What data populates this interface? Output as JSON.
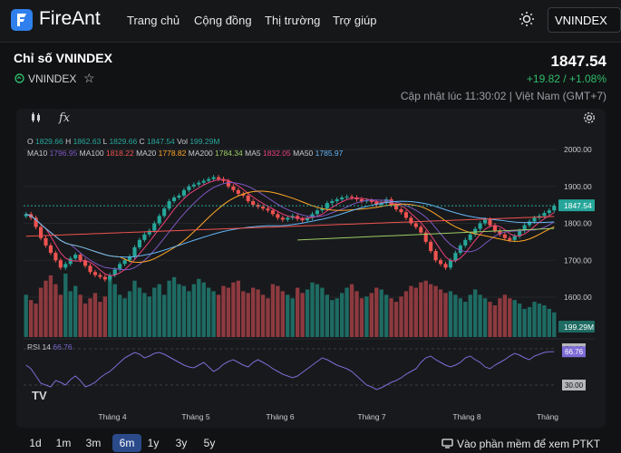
{
  "brand": {
    "name": "FireAnt"
  },
  "nav": {
    "items": [
      "Trang chủ",
      "Cộng đồng",
      "Thị trường",
      "Trợ giúp"
    ]
  },
  "search": {
    "value": "VNINDEX"
  },
  "header": {
    "title": "Chỉ số VNINDEX",
    "symbol": "VNINDEX",
    "price": "1847.54",
    "change": "+19.82 / +1.08%",
    "updated": "Cập nhật lúc 11:30:02 | Việt Nam (GMT+7)"
  },
  "legend": {
    "ohlc": [
      {
        "label": "O",
        "value": "1829.66"
      },
      {
        "label": "H",
        "value": "1862.63"
      },
      {
        "label": "L",
        "value": "1829.66"
      },
      {
        "label": "C",
        "value": "1847.54"
      },
      {
        "label": "Vol",
        "value": "199.29M"
      }
    ],
    "ma": [
      {
        "label": "MA10",
        "value": "1796.95"
      },
      {
        "label": "MA100",
        "value": "1818.22"
      },
      {
        "label": "MA20",
        "value": "1778.82"
      },
      {
        "label": "MA200",
        "value": "1784.34"
      },
      {
        "label": "MA5",
        "value": "1832.05"
      },
      {
        "label": "MA50",
        "value": "1785.97"
      }
    ],
    "rsi": {
      "label": "RSI 14",
      "value": "66.76"
    }
  },
  "colors": {
    "up": "#26a69a",
    "down": "#ef5350",
    "volume_up": "#1e6b63",
    "volume_down": "#8d3a3f",
    "ma10": "#7e57c2",
    "ma100": "#ef5350",
    "ma20": "#ffa726",
    "ma200": "#9ccc65",
    "ma5": "#ec407a",
    "ma50": "#64b5f6",
    "rsi": "#7e6bd6",
    "accent": "#2a4a8a"
  },
  "chart_data": {
    "type": "candlestick",
    "y_ticks": [
      "2000.00",
      "1900.00",
      "1800.00",
      "1700.00",
      "1600.00"
    ],
    "ylim": [
      1500,
      2050
    ],
    "last_price_label": "1847.54",
    "volume_label": "199.29M",
    "rsi_ticks": [
      "70.00",
      "30.00"
    ],
    "rsi_label": "66.76",
    "rsi_ylim": [
      0,
      100
    ],
    "x_ticks": [
      "Tháng 4",
      "Tháng 5",
      "Tháng 6",
      "Tháng 7",
      "Tháng 8",
      "Tháng"
    ],
    "close": [
      1825,
      1815,
      1790,
      1760,
      1740,
      1720,
      1700,
      1680,
      1690,
      1705,
      1715,
      1700,
      1685,
      1668,
      1660,
      1655,
      1648,
      1660,
      1675,
      1690,
      1700,
      1710,
      1735,
      1755,
      1770,
      1780,
      1800,
      1820,
      1840,
      1860,
      1870,
      1875,
      1890,
      1900,
      1905,
      1910,
      1915,
      1920,
      1925,
      1920,
      1915,
      1900,
      1890,
      1880,
      1875,
      1860,
      1850,
      1845,
      1840,
      1835,
      1825,
      1815,
      1810,
      1815,
      1820,
      1812,
      1808,
      1815,
      1825,
      1835,
      1840,
      1855,
      1860,
      1865,
      1870,
      1872,
      1870,
      1865,
      1860,
      1862,
      1858,
      1850,
      1855,
      1865,
      1850,
      1838,
      1830,
      1815,
      1800,
      1790,
      1775,
      1750,
      1725,
      1700,
      1690,
      1680,
      1700,
      1720,
      1740,
      1755,
      1770,
      1785,
      1800,
      1810,
      1795,
      1780,
      1770,
      1760,
      1755,
      1765,
      1780,
      1795,
      1805,
      1815,
      1820,
      1828,
      1835,
      1847.54
    ],
    "volume": [
      120,
      105,
      95,
      140,
      160,
      175,
      150,
      120,
      180,
      130,
      145,
      120,
      95,
      110,
      125,
      100,
      115,
      170,
      150,
      120,
      110,
      130,
      160,
      140,
      125,
      115,
      140,
      150,
      120,
      160,
      170,
      150,
      145,
      130,
      150,
      165,
      155,
      140,
      130,
      120,
      145,
      140,
      155,
      160,
      130,
      125,
      140,
      135,
      120,
      110,
      150,
      145,
      130,
      120,
      110,
      140,
      125,
      135,
      155,
      150,
      140,
      120,
      105,
      110,
      125,
      140,
      150,
      130,
      110,
      115,
      125,
      140,
      135,
      120,
      110,
      100,
      115,
      130,
      145,
      140,
      155,
      160,
      150,
      145,
      135,
      125,
      130,
      120,
      110,
      100,
      120,
      135,
      120,
      110,
      100,
      90,
      110,
      120,
      110,
      105,
      95,
      80,
      85,
      100,
      95,
      90,
      80,
      70
    ],
    "rsi": [
      52,
      48,
      40,
      32,
      30,
      28,
      35,
      33,
      30,
      36,
      40,
      35,
      28,
      30,
      33,
      38,
      42,
      45,
      50,
      55,
      60,
      63,
      66,
      64,
      60,
      62,
      65,
      66,
      64,
      61,
      58,
      55,
      52,
      50,
      49,
      52,
      55,
      50,
      45,
      48,
      53,
      56,
      58,
      55,
      52,
      50,
      55,
      58,
      55,
      52,
      48,
      45,
      42,
      40,
      38,
      40,
      44,
      48,
      52,
      56,
      60,
      58,
      55,
      52,
      50,
      48,
      45,
      40,
      35,
      30,
      28,
      25,
      27,
      30,
      33,
      35,
      38,
      42,
      45,
      48,
      55,
      60,
      62,
      58,
      55,
      52,
      50,
      52,
      55,
      60,
      62,
      58,
      55,
      50,
      48,
      52,
      55,
      58,
      62,
      65,
      63,
      60,
      58,
      62,
      64,
      66,
      66.76,
      66.76
    ]
  },
  "toolbar": {
    "indicator_label": "fx"
  },
  "timeframes": [
    "1d",
    "1m",
    "3m",
    "6m",
    "1y",
    "3y",
    "5y"
  ],
  "active_timeframe": "6m",
  "footer": {
    "ptkt_label": "Vào phần mềm để xem PTKT"
  },
  "watermark": "TV"
}
